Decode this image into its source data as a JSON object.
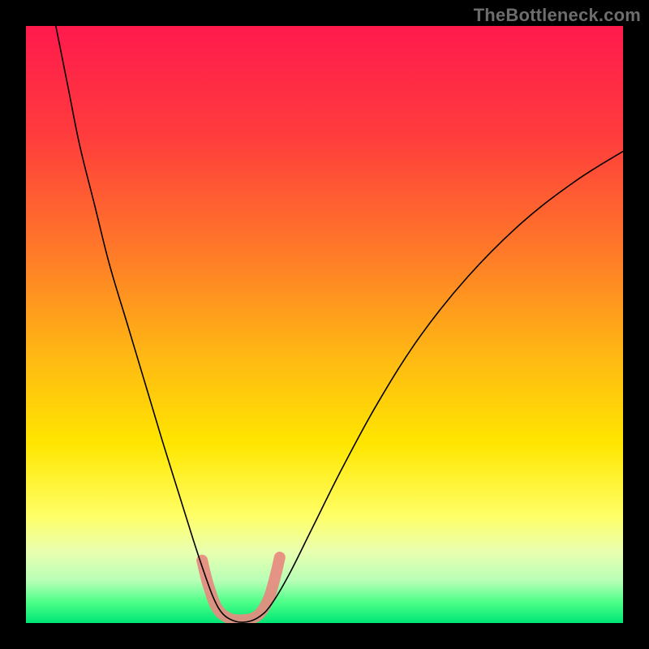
{
  "watermark": "TheBottleneck.com",
  "chart_data": {
    "type": "line",
    "title": "",
    "xlabel": "",
    "ylabel": "",
    "xlim": [
      0,
      100
    ],
    "ylim": [
      0,
      100
    ],
    "gradient_stops": [
      {
        "offset": 0.0,
        "color": "#ff1a4d"
      },
      {
        "offset": 0.18,
        "color": "#ff3b3d"
      },
      {
        "offset": 0.38,
        "color": "#ff7a28"
      },
      {
        "offset": 0.55,
        "color": "#ffb714"
      },
      {
        "offset": 0.7,
        "color": "#ffe600"
      },
      {
        "offset": 0.82,
        "color": "#ffff66"
      },
      {
        "offset": 0.88,
        "color": "#eaffb0"
      },
      {
        "offset": 0.93,
        "color": "#b6ffb6"
      },
      {
        "offset": 0.965,
        "color": "#4dff88"
      },
      {
        "offset": 1.0,
        "color": "#00e676"
      }
    ],
    "series": [
      {
        "name": "bottleneck-curve",
        "stroke": "#000000",
        "stroke_width": 1.6,
        "points": [
          {
            "x": 5.0,
            "y": 100.0
          },
          {
            "x": 7.0,
            "y": 90.0
          },
          {
            "x": 9.0,
            "y": 80.0
          },
          {
            "x": 11.5,
            "y": 70.0
          },
          {
            "x": 14.0,
            "y": 60.0
          },
          {
            "x": 17.0,
            "y": 50.0
          },
          {
            "x": 20.0,
            "y": 40.0
          },
          {
            "x": 23.0,
            "y": 30.0
          },
          {
            "x": 25.5,
            "y": 22.0
          },
          {
            "x": 28.0,
            "y": 14.0
          },
          {
            "x": 30.0,
            "y": 8.0
          },
          {
            "x": 31.5,
            "y": 4.0
          },
          {
            "x": 33.0,
            "y": 1.5
          },
          {
            "x": 35.0,
            "y": 0.3
          },
          {
            "x": 37.0,
            "y": 0.2
          },
          {
            "x": 39.0,
            "y": 1.0
          },
          {
            "x": 41.0,
            "y": 3.0
          },
          {
            "x": 44.0,
            "y": 8.0
          },
          {
            "x": 48.0,
            "y": 16.0
          },
          {
            "x": 53.0,
            "y": 26.0
          },
          {
            "x": 59.0,
            "y": 37.0
          },
          {
            "x": 66.0,
            "y": 48.0
          },
          {
            "x": 74.0,
            "y": 58.0
          },
          {
            "x": 83.0,
            "y": 67.0
          },
          {
            "x": 92.0,
            "y": 74.0
          },
          {
            "x": 100.0,
            "y": 79.0
          }
        ]
      },
      {
        "name": "highlight-band",
        "stroke": "#e78a80",
        "stroke_width": 14,
        "points": [
          {
            "x": 29.5,
            "y": 10.5
          },
          {
            "x": 30.5,
            "y": 6.5
          },
          {
            "x": 32.0,
            "y": 2.5
          },
          {
            "x": 34.0,
            "y": 0.8
          },
          {
            "x": 36.0,
            "y": 0.5
          },
          {
            "x": 38.0,
            "y": 0.8
          },
          {
            "x": 39.5,
            "y": 2.0
          },
          {
            "x": 40.8,
            "y": 4.5
          },
          {
            "x": 41.8,
            "y": 8.0
          },
          {
            "x": 42.5,
            "y": 11.0
          }
        ]
      }
    ]
  }
}
